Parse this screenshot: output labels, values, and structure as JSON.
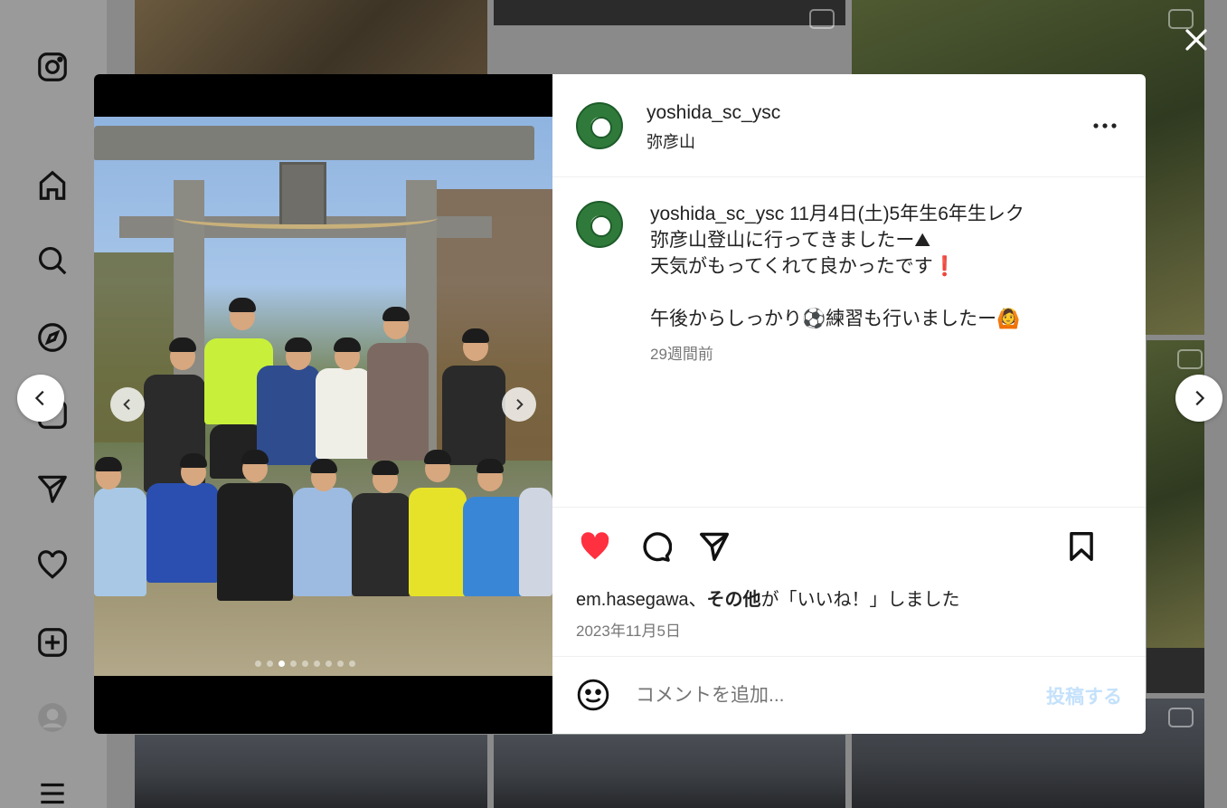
{
  "post": {
    "username": "yoshida_sc_ysc",
    "location": "弥彦山",
    "caption_user": "yoshida_sc_ysc",
    "caption_lines": "11月4日(土)5年生6年生レク\n弥彦山登山に行ってきましたー⛰\n天気がもってくれて良かったです❗\n\n午後からしっかり⚽練習も行いましたー🙆",
    "caption_time": "29週間前",
    "likes_user": "em.hasegawa",
    "likes_sep": "、",
    "likes_others": "その他",
    "likes_suffix": "が「いいね！」しました",
    "date": "2023年11月5日",
    "carousel_count": 9,
    "carousel_active": 2
  },
  "comment": {
    "placeholder": "コメントを追加...",
    "submit_label": "投稿する"
  },
  "colors": {
    "like_red": "#ff3040",
    "post_disabled": "#c4e1fb"
  },
  "icons": {
    "sidebar": [
      "instagram-logo-icon",
      "home-icon",
      "search-icon",
      "explore-icon",
      "reels-icon",
      "send-icon",
      "heart-icon",
      "create-icon",
      "profile-avatar-icon",
      "menu-icon"
    ],
    "actions": [
      "heart-filled-icon",
      "comment-icon",
      "share-icon",
      "bookmark-icon"
    ]
  }
}
